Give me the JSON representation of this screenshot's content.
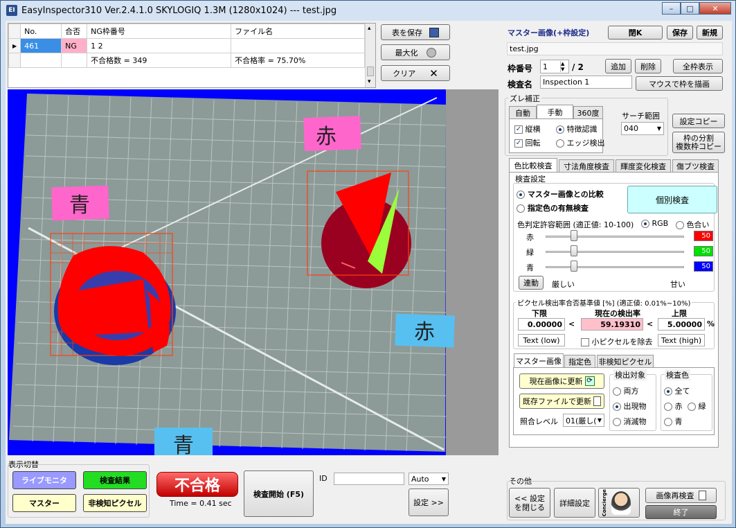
{
  "window": {
    "title": "EasyInspector310 Ver.2.4.1.0 SKYLOGIQ 1.3M  (1280x1024) --- test.jpg",
    "logo": "EI",
    "minimize": "–",
    "maximize": "□",
    "close": "✕"
  },
  "table": {
    "headers": [
      "No.",
      "合否",
      "NG枠番号",
      "ファイル名"
    ],
    "row1": {
      "no": "461",
      "result": "NG",
      "ng": "1 2",
      "file": ""
    },
    "row2": {
      "reject_count": "不合格数 = 349",
      "reject_rate": "不合格率 = 75.70%"
    },
    "row_marker": "▶",
    "scroll_up": "▴",
    "scroll_down": "▾"
  },
  "table_buttons": {
    "save": "表を保存",
    "maximize": "最大化",
    "clear": "クリア"
  },
  "master": {
    "header": "マスター画像(+枠設定)",
    "close": "閉K",
    "save": "保存",
    "new": "新規",
    "filename": "test.jpg"
  },
  "frame": {
    "label": "枠番号",
    "value": "1",
    "total": "/ 2",
    "add": "追加",
    "delete": "削除",
    "show_all": "全枠表示"
  },
  "inspection": {
    "label": "検査名",
    "value": "Inspection 1",
    "draw": "マウスで枠を描画"
  },
  "shift": {
    "title": "ズレ補正",
    "tabs": [
      "自動",
      "手動",
      "360度"
    ],
    "vh": "縦横",
    "rotate": "回転",
    "feature": "特徴認識",
    "edge": "エッジ検出",
    "search_label": "サーチ範囲",
    "search_value": "040",
    "copy": "設定コピー",
    "split1": "枠の分割",
    "split2": "複数枠コピー"
  },
  "insp_tabs": [
    "色比較検査",
    "寸法角度検査",
    "輝度変化検査",
    "傷ブツ検査"
  ],
  "settings": {
    "title": "検査設定",
    "compare_master": "マスター画像との比較",
    "color_presence": "指定色の有無検査",
    "individual": "個別検査",
    "tolerance": "色判定許容範囲 (適正値: 10-100)",
    "rgb": "RGB",
    "hue": "色合い",
    "red": "赤",
    "green": "緑",
    "blue": "青",
    "red_val": "50",
    "green_val": "50",
    "blue_val": "50",
    "link": "連動",
    "strict": "厳しい",
    "loose": "甘い"
  },
  "pixel": {
    "title": "ピクセル検出率合否基準値 [%] (適正値: 0.01%~10%)",
    "lower": "下限",
    "current": "現在の検出率",
    "upper": "上限",
    "lower_val": "0.00000",
    "current_val": "59.19310",
    "upper_val": "5.00000",
    "lt": "<",
    "pct": "%",
    "text_low": "Text (low)",
    "small_px": "小ピクセルを除去",
    "text_high": "Text (high)"
  },
  "bottom_tabs": [
    "マスター画像",
    "指定色",
    "非検知ピクセル"
  ],
  "master_img": {
    "update_current": "現在画像に更新",
    "update_file": "既存ファイルで更新",
    "match_label": "照合レベル",
    "match_value": "01(厳し(",
    "target_title": "検出対象",
    "both": "両方",
    "appear": "出現物",
    "vanish": "消滅物",
    "color_title": "検査色",
    "all": "全て",
    "c_red": "赤",
    "c_green": "緑",
    "c_blue": "青"
  },
  "display": {
    "title": "表示切替",
    "live": "ライブモニタ",
    "result": "検査結果",
    "master": "マスター",
    "nondetect": "非検知ピクセル"
  },
  "verdict": {
    "label": "不合格",
    "time": "Time = 0.41 sec"
  },
  "run": {
    "start": "検査開始 (F5)",
    "id_label": "ID",
    "id_value": "",
    "auto": "Auto",
    "settings": "設定 >>"
  },
  "other": {
    "title": "その他",
    "close_settings_1": "<< 設定",
    "close_settings_2": "を閉じる",
    "detail": "詳細設定",
    "concierge": "Concierge",
    "reinspect": "画像再検査",
    "exit": "終了"
  },
  "image_labels": {
    "aka1": "赤",
    "ao1": "青",
    "aka2": "赤",
    "ao2": "青"
  },
  "colors": {
    "selected": "#3a8ee6",
    "ng_cell": "#ffb0c8",
    "verdict": "#d42020",
    "current_bg": "#ffc0cc",
    "cyan_btn": "#ccffff",
    "blue_bg": "#0000ff"
  }
}
